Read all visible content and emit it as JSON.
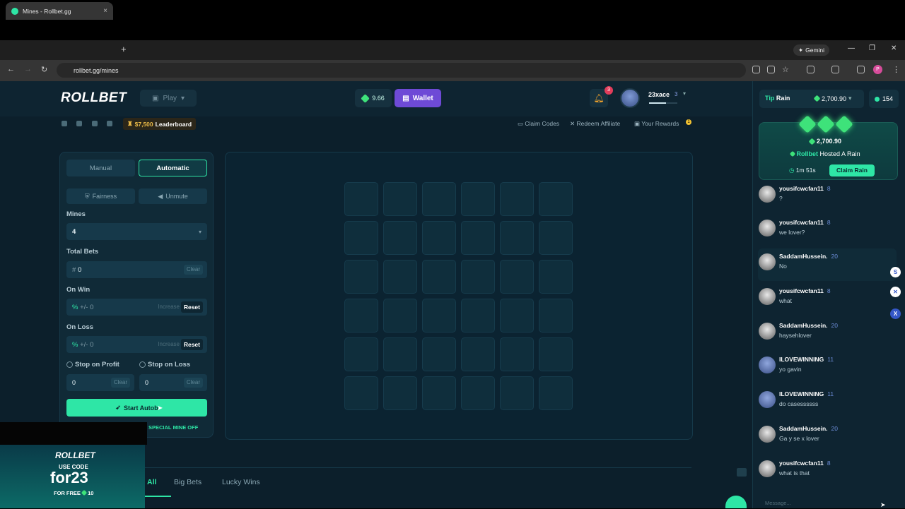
{
  "browser": {
    "tab_title": "Mines - Rollbet.gg",
    "url": "rollbet.gg/mines",
    "gemini_label": "Gemini",
    "profile_initial": "P"
  },
  "header": {
    "logo": "ROLLBET",
    "play_label": "Play",
    "balance": "9.66",
    "wallet_label": "Wallet",
    "notif_count": "3",
    "username": "23xace",
    "user_level": "3",
    "xp_progress": 0.6
  },
  "subnav": {
    "leaderboard_amount": "$7,500",
    "leaderboard_label": "Leaderboard",
    "claim_codes": "Claim Codes",
    "redeem_affiliate": "Redeem Affiliate",
    "your_rewards": "Your Rewards",
    "rewards_badge": "1"
  },
  "panel": {
    "manual_label": "Manual",
    "auto_label": "Automatic",
    "fairness_label": "Fairness",
    "unmute_label": "Unmute",
    "mines_label": "Mines",
    "mines_value": "4",
    "total_bets_label": "Total Bets",
    "total_bets_prefix": "#",
    "total_bets_value": "0",
    "clear_label": "Clear",
    "on_win_label": "On Win",
    "on_loss_label": "On Loss",
    "percent_prefix": "%",
    "pm_value": "+/- 0",
    "increase_label": "Increase",
    "reset_label": "Reset",
    "stop_profit_label": "Stop on Profit",
    "stop_loss_label": "Stop on Loss",
    "stop_profit_value": "0",
    "stop_loss_value": "0",
    "start_label": "Start Autob",
    "special_label": "SPECIAL MINE OFF"
  },
  "bottom_tabs": {
    "all": "All",
    "big_bets": "Big Bets",
    "lucky_wins": "Lucky Wins"
  },
  "promo": {
    "brand": "ROLLBET",
    "use_code": "USE CODE",
    "code": "for23",
    "for_free": "FOR FREE",
    "free_amount": "10"
  },
  "chat": {
    "tip_word": "Tip",
    "rain_word": "Rain",
    "rain_amount": "2,700.90",
    "online_count": "154",
    "rain_card_amount": "2,700.90",
    "host_brand": "Rollbet",
    "host_text": "Hosted A Rain",
    "timer": "1m 51s",
    "claim_label": "Claim Rain",
    "input_placeholder": "Message...",
    "messages": [
      {
        "name": "yousifcwcfan11",
        "level": "8",
        "text": "?"
      },
      {
        "name": "yousifcwcfan11",
        "level": "8",
        "text": "we lover?"
      },
      {
        "name": "SaddamHussein.",
        "level": "20",
        "text": "No"
      },
      {
        "name": "yousifcwcfan11",
        "level": "8",
        "text": "what"
      },
      {
        "name": "SaddamHussein.",
        "level": "20",
        "text": "haysehlover"
      },
      {
        "name": "ILOVEWINNING",
        "level": "11",
        "text": "yo gavin"
      },
      {
        "name": "ILOVEWINNING",
        "level": "11",
        "text": "do casessssss"
      },
      {
        "name": "SaddamHussein.",
        "level": "20",
        "text": "Ga y se x lover"
      },
      {
        "name": "yousifcwcfan11",
        "level": "8",
        "text": "what is that"
      }
    ]
  },
  "colors": {
    "accent": "#2ee6a6",
    "wallet": "#6e4ad6",
    "background": "#0c1f2b"
  }
}
